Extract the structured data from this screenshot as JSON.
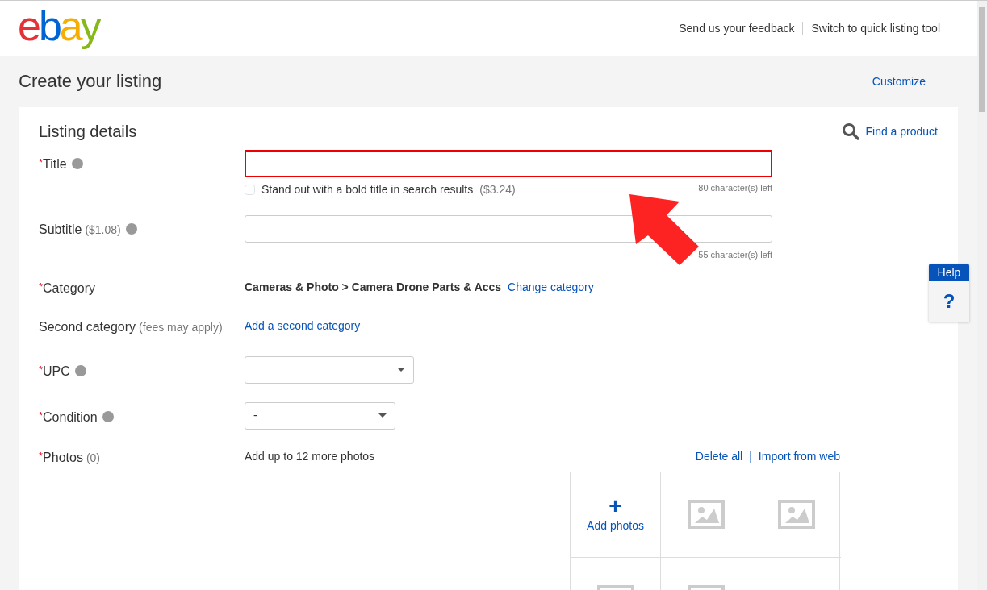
{
  "header": {
    "logo": "ebay",
    "links": [
      "Send us your feedback",
      "Switch to quick listing tool"
    ]
  },
  "page_title": "Create your listing",
  "customize": "Customize",
  "section": {
    "title": "Listing details",
    "find_product": "Find a product"
  },
  "fields": [
    {
      "kind": "text",
      "label": "Title",
      "marker": "*",
      "info": true,
      "error": true,
      "checkbox": {
        "label": "Stand out with a bold title in search results",
        "note": "($3.24)",
        "checked": false
      },
      "counter": "80 character(s) left"
    },
    {
      "kind": "text",
      "label": "Subtitle",
      "note": "($1.08)",
      "info": true,
      "error": false,
      "counter": "55 character(s) left"
    },
    {
      "kind": "category",
      "label": "Category",
      "marker": "*",
      "value": "Cameras & Photo > Camera Drone Parts & Accs",
      "link": "Change category"
    },
    {
      "kind": "link",
      "label": "Second category",
      "note": "(fees may apply)",
      "link": "Add a second category"
    },
    {
      "kind": "select",
      "label": "UPC",
      "marker": "*",
      "info": true
    },
    {
      "kind": "select",
      "label": "Condition",
      "marker": "*",
      "info": true,
      "value": "-"
    },
    {
      "kind": "photos",
      "label": "Photos",
      "note": "(0)",
      "marker": "*",
      "hint": "Add up to 12 more photos",
      "actions": [
        "Delete all",
        "Import from web"
      ],
      "separator": "|",
      "add_label": "Add photos",
      "add_icon": "+"
    }
  ],
  "help": {
    "title": "Help",
    "icon": "?"
  }
}
